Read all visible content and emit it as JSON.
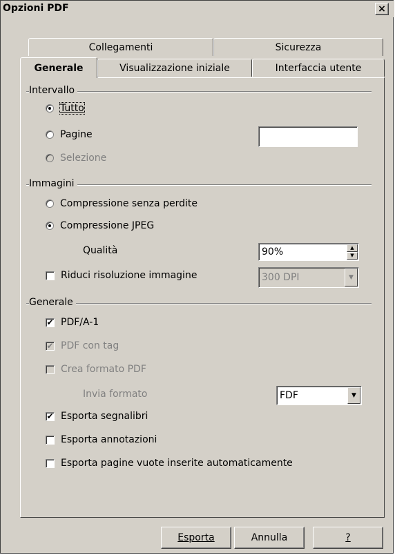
{
  "window": {
    "title": "Opzioni PDF",
    "close": "×"
  },
  "tabs": {
    "row1": [
      "Collegamenti",
      "Sicurezza"
    ],
    "row2": [
      "Generale",
      "Visualizzazione iniziale",
      "Interfaccia utente"
    ],
    "active": "Generale"
  },
  "intervallo": {
    "label": "Intervallo",
    "tutto": "Tutto",
    "pagine": "Pagine",
    "pagine_value": "",
    "selezione": "Selezione",
    "selected": "Tutto"
  },
  "immagini": {
    "label": "Immagini",
    "lossless": "Compressione senza perdite",
    "jpeg": "Compressione JPEG",
    "selected": "Compressione JPEG",
    "qualita_label": "Qualità",
    "qualita_value": "90%",
    "riduci_label": "Riduci risoluzione immagine",
    "riduci_checked": false,
    "resolution_value": "300 DPI"
  },
  "generale": {
    "label": "Generale",
    "pdfa": "PDF/A-1",
    "pdfa_checked": true,
    "tagged": "PDF con tag",
    "tagged_checked": true,
    "form": "Crea formato PDF",
    "form_checked": false,
    "submit_label": "Invia formato",
    "submit_value": "FDF",
    "bookmarks": "Esporta segnalibri",
    "bookmarks_checked": true,
    "notes": "Esporta annotazioni",
    "notes_checked": false,
    "empty_pages": "Esporta pagine vuote inserite automaticamente",
    "empty_pages_checked": false
  },
  "buttons": {
    "export": "Esporta",
    "cancel": "Annulla",
    "help": "?"
  },
  "icons": {
    "check": "✔",
    "spin_up": "▲",
    "spin_down": "▼",
    "dropdown": "▼"
  }
}
